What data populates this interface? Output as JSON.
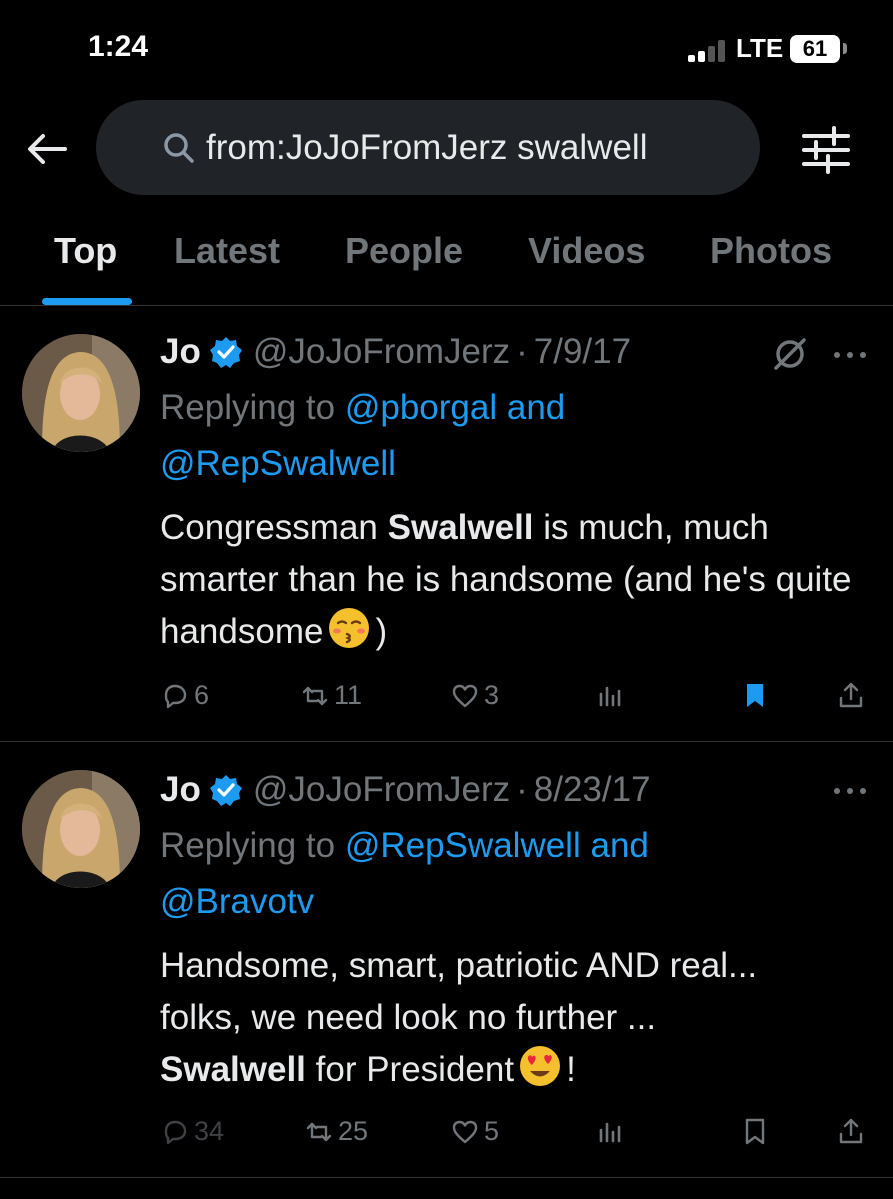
{
  "status_bar": {
    "time": "1:24",
    "network": "LTE",
    "battery": "61"
  },
  "search": {
    "query": "from:JoJoFromJerz swalwell"
  },
  "tabs": [
    {
      "label": "Top",
      "active": true
    },
    {
      "label": "Latest",
      "active": false
    },
    {
      "label": "People",
      "active": false
    },
    {
      "label": "Videos",
      "active": false
    },
    {
      "label": "Photos",
      "active": false
    }
  ],
  "tweets": [
    {
      "name": "Jo",
      "handle": "@JoJoFromJerz",
      "separator": "·",
      "date": "7/9/17",
      "replying_prefix": "Replying to",
      "mention_1": "@pborgal",
      "and_word": "and",
      "mention_2": "@RepSwalwell",
      "body_pre": "Congressman",
      "body_bold": "Swalwell",
      "body_post": "is much, much smarter than he is handsome (and he's quite handsome",
      "body_end": ")",
      "stats": {
        "replies": "6",
        "retweets": "11",
        "likes": "3"
      }
    },
    {
      "name": "Jo",
      "handle": "@JoJoFromJerz",
      "separator": "·",
      "date": "8/23/17",
      "replying_prefix": "Replying to",
      "mention_1": "@RepSwalwell",
      "and_word": "and",
      "mention_2": "@Bravotv",
      "body_line_1": "Handsome, smart, patriotic AND real...",
      "body_line_2": "folks, we need look no further ...",
      "body_bold": "Swalwell",
      "body_line_3": "for President",
      "body_end": "!",
      "stats": {
        "replies": "34",
        "retweets": "25",
        "likes": "5"
      }
    }
  ],
  "colors": {
    "accent": "#1d9bf0",
    "muted": "#71767b",
    "background": "#000000",
    "search_bg": "#202327"
  }
}
